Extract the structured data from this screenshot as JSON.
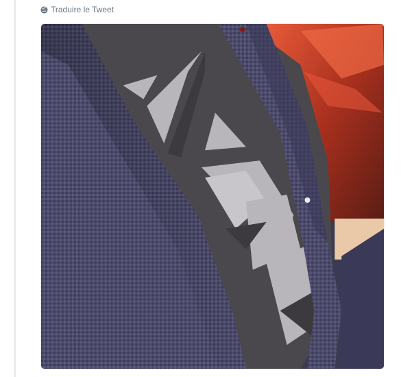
{
  "tweet": {
    "translate_label": "Traduire le Tweet",
    "translate_icon": "globe-icon",
    "media": {
      "alt": "",
      "colors": {
        "fabric": "#4b4a6a",
        "fabric_dark": "#2e2d45",
        "shirt": "#b8b6ba",
        "shirt_dark": "#3c3a3e",
        "background_red": "#b8341f",
        "background_bright": "#e85a3a",
        "wall": "#e9c9a8"
      }
    }
  },
  "colors": {
    "muted_text": "#657786",
    "thread_line": "#e6ecf0"
  }
}
